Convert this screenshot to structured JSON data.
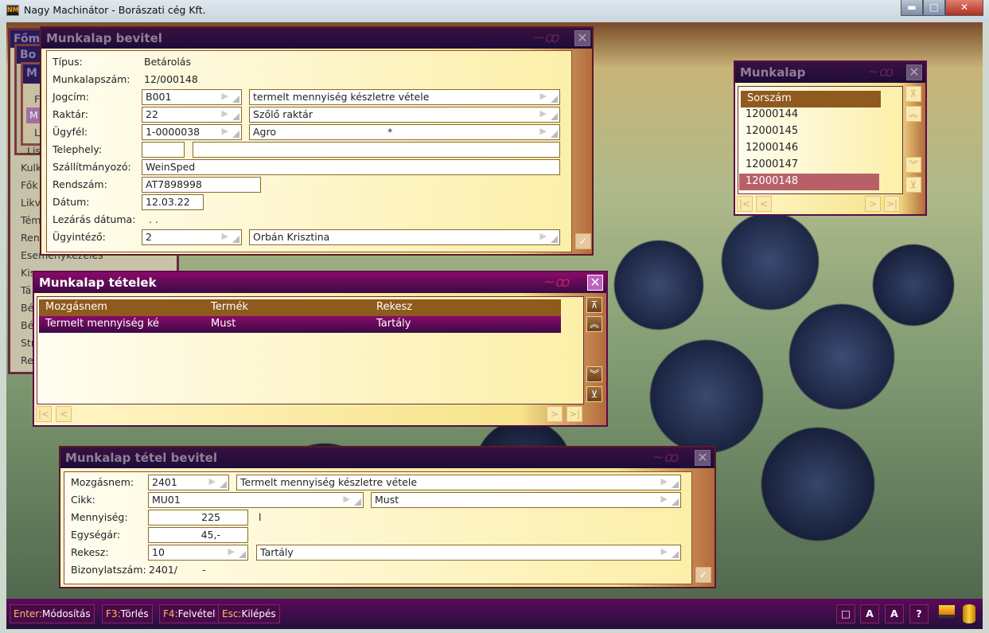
{
  "app": {
    "title": "Nagy Machinátor - Borászati cég Kft.",
    "icon_text": "NM"
  },
  "window_controls": {
    "minimize": "▬",
    "maximize": "□",
    "close": "✕"
  },
  "background_windows": {
    "titles": [
      "Főm",
      "Bo",
      "M"
    ],
    "submenu": [
      "F",
      "M",
      "L",
      "Lis"
    ],
    "menu_items": [
      "Kulk",
      "Fők",
      "Likv",
      "Tém",
      "Ren",
      "Eseménykezelés",
      "Kis",
      "Tá",
      "Bé",
      "Bé",
      "Str",
      "Re"
    ]
  },
  "munkalap_bevitel": {
    "title": "Munkalap bevitel",
    "tipus": {
      "label": "Típus:",
      "value": "Betárolás"
    },
    "munkalapszam": {
      "label": "Munkalapszám:",
      "value": "12/000148"
    },
    "jogcim": {
      "label": "Jogcím:",
      "code": "B001",
      "desc": "termelt mennyiség készletre vétele"
    },
    "raktar": {
      "label": "Raktár:",
      "code": "22",
      "desc": "Szőlő raktár"
    },
    "ugyfel": {
      "label": "Ügyfél:",
      "code": "1-0000038",
      "desc": "Agro",
      "marker": "*"
    },
    "telephely": {
      "label": "Telephely:",
      "code": "",
      "desc": ""
    },
    "szallitmanyozo": {
      "label": "Szállítmányozó:",
      "value": "WeinSped"
    },
    "rendszam": {
      "label": "Rendszám:",
      "value": "AT7898998"
    },
    "datum": {
      "label": "Dátum:",
      "value": "12.03.22"
    },
    "lezaras": {
      "label": "Lezárás dátuma:",
      "value": ". ."
    },
    "ugyintezo": {
      "label": "Ügyintéző:",
      "code": "2",
      "desc": "Orbán Krisztina"
    }
  },
  "munkalap_list": {
    "title": "Munkalap",
    "header": "Sorszám",
    "rows": [
      "12000144",
      "12000145",
      "12000146",
      "12000147",
      "12000148"
    ],
    "selected": "12000148"
  },
  "tetelek": {
    "title": "Munkalap tételek",
    "columns": [
      "Mozgásnem",
      "Termék",
      "Rekesz"
    ],
    "rows": [
      [
        "Termelt mennyiség ké",
        "Must",
        "Tartály"
      ]
    ]
  },
  "tetel_bevitel": {
    "title": "Munkalap tétel bevitel",
    "mozgasnem": {
      "label": "Mozgásnem:",
      "code": "2401",
      "desc": "Termelt mennyiség készletre vétele"
    },
    "cikk": {
      "label": "Cikk:",
      "code": "MU01",
      "desc": "Must"
    },
    "mennyiseg": {
      "label": "Mennyiség:",
      "value": "225",
      "unit": "l"
    },
    "egysegar": {
      "label": "Egységár:",
      "value": "45,-"
    },
    "rekesz": {
      "label": "Rekesz:",
      "code": "10",
      "desc": "Tartály"
    },
    "bizonylatszam": {
      "label": "Bizonylatszám:",
      "value": "2401/",
      "suffix": "-"
    }
  },
  "nav_icons": {
    "first": "⊼",
    "prev_page": "︽",
    "next_page": "︾",
    "last": "⊻",
    "home": "|<",
    "left": "<",
    "right": ">",
    "end": ">|",
    "ok": "✓",
    "close": "✕",
    "swirl": "~ꝏ"
  },
  "bottombar": {
    "keys": [
      {
        "key": "Enter:",
        "label": "Módosítás"
      },
      {
        "key": "F3:",
        "label": "Törlés"
      },
      {
        "key": "F4:",
        "label": "Felvétel"
      },
      {
        "key": "Esc:",
        "label": "Kilépés"
      }
    ],
    "tools": {
      "window": "□",
      "font_large": "A",
      "font_small": "A",
      "help": "?"
    }
  },
  "colors": {
    "title_active": "#8a0a6a",
    "title_inactive": "#1c0c3a",
    "header_row": "#8f5a1e",
    "selected_row": "#b8606a",
    "panel": "#fcefa8"
  }
}
